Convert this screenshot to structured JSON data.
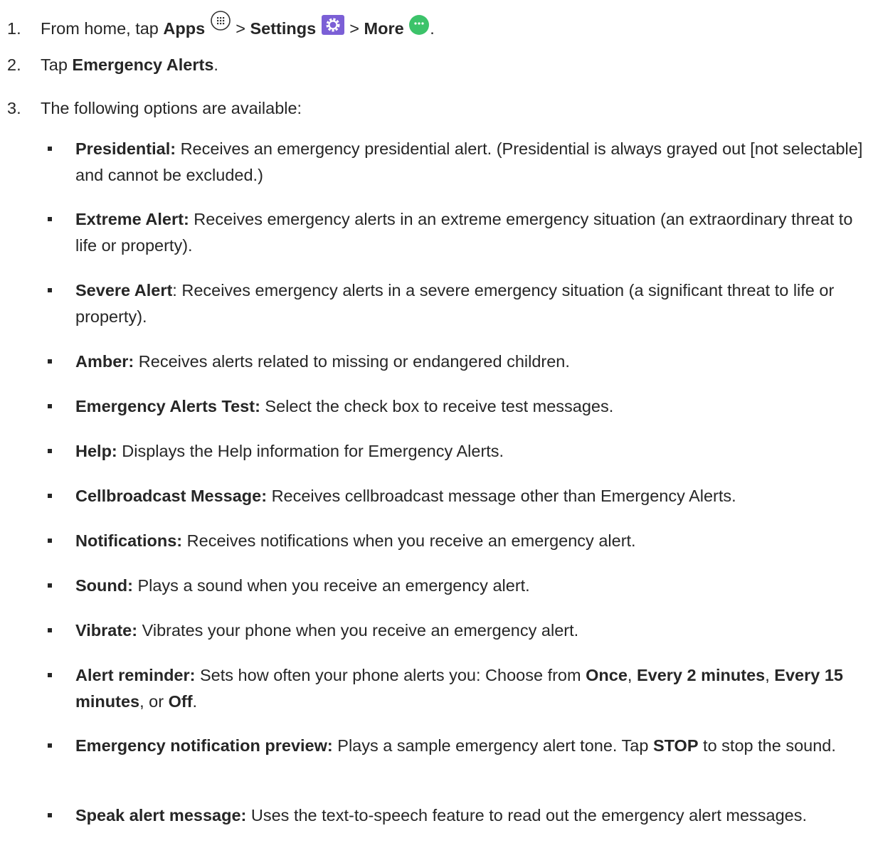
{
  "steps": [
    {
      "num": "1.",
      "pre": "From home, tap ",
      "apps": "Apps",
      "sep1": " > ",
      "settings": "Settings",
      "sep2": " > ",
      "more": "More",
      "end": "."
    },
    {
      "num": "2.",
      "pre": "Tap ",
      "bold": "Emergency Alerts",
      "end": "."
    },
    {
      "num": "3.",
      "text": "The following options are available:"
    }
  ],
  "options": [
    {
      "label": "Presidential:",
      "desc": " Receives an emergency presidential alert. (Presidential is always grayed out [not selectable] and cannot be excluded.)"
    },
    {
      "label": "Extreme Alert:",
      "desc": " Receives emergency alerts in an extreme emergency situation (an extraordinary threat to life or property)."
    },
    {
      "label": "Severe Alert",
      "desc": ": Receives emergency alerts in a severe emergency situation (a significant threat to life or property)."
    },
    {
      "label": "Amber:",
      "desc": " Receives alerts related to missing or endangered children."
    },
    {
      "label": "Emergency Alerts Test:",
      "desc": " Select the check box to receive test messages."
    },
    {
      "label": "Help:",
      "desc": " Displays the Help information for Emergency Alerts."
    },
    {
      "label": "Cellbroadcast Message:",
      "desc": " Receives cellbroadcast message other than Emergency Alerts."
    },
    {
      "label": "Notifications:",
      "desc": " Receives notifications when you receive an emergency alert."
    },
    {
      "label": "Sound:",
      "desc": " Plays a sound when you receive an emergency alert."
    },
    {
      "label": "Vibrate:",
      "desc": " Vibrates your phone when you receive an emergency alert."
    },
    {
      "label": "Alert reminder:",
      "desc": " Sets how often your phone alerts you: Choose from ",
      "o1": "Once",
      "c1": ", ",
      "o2": "Every 2 minutes",
      "c2": ", ",
      "o3": "Every 15 minutes",
      "c3": ", or ",
      "o4": "Off",
      "c4": "."
    },
    {
      "label": "Emergency notification preview:",
      "desc": " Plays a sample emergency alert tone. Tap ",
      "stop": "STOP",
      "desc2": " to stop the sound."
    },
    {
      "label": "Speak alert message:",
      "desc": " Uses the text-to-speech feature to read out the emergency alert messages."
    }
  ],
  "icons": {
    "apps": "apps-icon",
    "settings": "settings-gear-icon",
    "more": "more-dots-icon",
    "settings_color": "#7b5fd6",
    "more_color": "#3cc36a"
  }
}
